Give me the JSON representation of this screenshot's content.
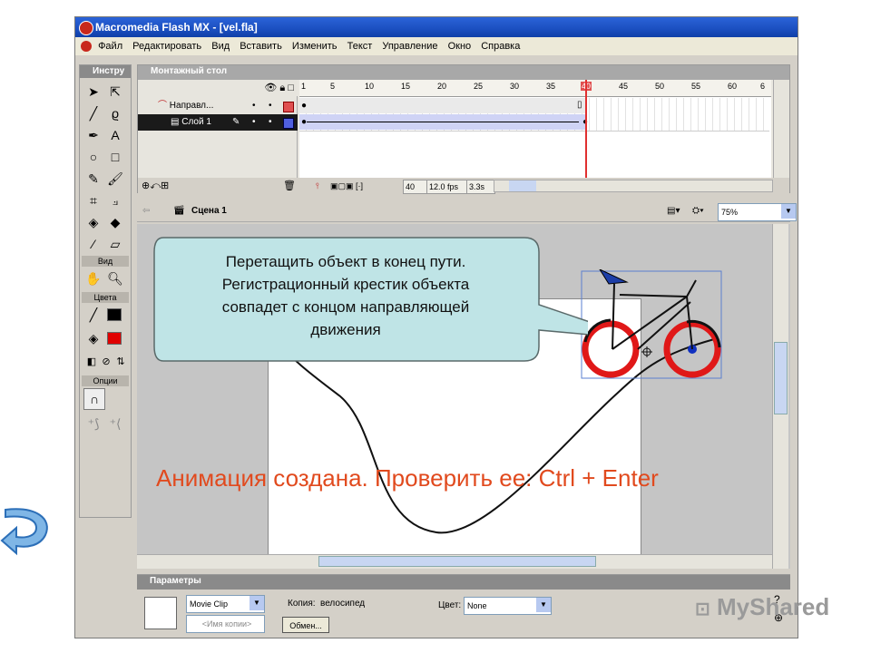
{
  "window": {
    "title": "Macromedia Flash MX - [vel.fla]"
  },
  "menu": [
    "Файл",
    "Редактировать",
    "Вид",
    "Вставить",
    "Изменить",
    "Текст",
    "Управление",
    "Окно",
    "Справка"
  ],
  "tools_panel": {
    "title": "Инстру",
    "sections": {
      "view": "Вид",
      "colors": "Цвета",
      "options": "Опции"
    },
    "stroke_color": "#000000",
    "fill_color": "#e00000"
  },
  "timeline": {
    "title": "Монтажный стол",
    "ruler_ticks": [
      "1",
      "5",
      "10",
      "15",
      "20",
      "25",
      "30",
      "35",
      "40",
      "45",
      "50",
      "55",
      "60",
      "6"
    ],
    "playhead_frame": 40,
    "layers": [
      {
        "name": "Направл...",
        "type": "guide",
        "color": "#e05050"
      },
      {
        "name": "Слой 1",
        "type": "normal",
        "selected": true,
        "color": "#5060e0"
      }
    ],
    "status": {
      "frame": "40",
      "fps": "12.0 fps",
      "time": "3.3s"
    }
  },
  "scene": {
    "name": "Сцена 1",
    "zoom": "75%"
  },
  "callout": {
    "text_lines": [
      "Перетащить объект в конец пути.",
      "Регистрационный крестик объекта",
      "совпадет с концом направляющей",
      "движения"
    ],
    "bg_color": "#bfe4e6"
  },
  "annotation": {
    "text": "Анимация создана. Проверить ее: Ctrl + Enter",
    "color": "#e14a1e"
  },
  "parameters_panel": {
    "title": "Параметры",
    "symbol_type": "Movie Clip",
    "instance_label": "Копия:",
    "instance_value": "велосипед",
    "instance_name_placeholder": "<Имя копии>",
    "swap_button": "Обмен...",
    "color_label": "Цвет:",
    "color_value": "None"
  },
  "watermark": "MyShared"
}
